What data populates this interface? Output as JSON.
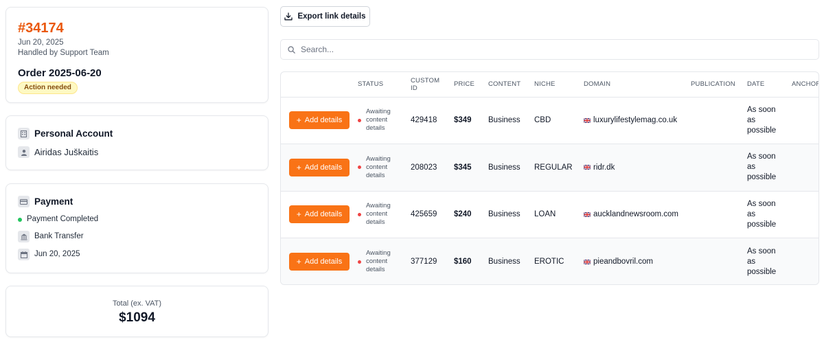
{
  "order": {
    "id": "#34174",
    "date": "Jun 20, 2025",
    "handler": "Handled by Support Team",
    "title": "Order 2025-06-20",
    "badge": "Action needed"
  },
  "account": {
    "title": "Personal Account",
    "name": "Airidas Juškaitis"
  },
  "payment": {
    "title": "Payment",
    "status": "Payment Completed",
    "method": "Bank Transfer",
    "date": "Jun 20, 2025"
  },
  "total": {
    "label": "Total (ex. VAT)",
    "value": "$1094"
  },
  "toolbar": {
    "export_label": "Export link details"
  },
  "search": {
    "placeholder": "Search..."
  },
  "table": {
    "columns": [
      "",
      "STATUS",
      "CUSTOM ID",
      "PRICE",
      "CONTENT",
      "NICHE",
      "DOMAIN",
      "PUBLICATION",
      "DATE",
      "ANCHOR"
    ],
    "add_label": "Add details",
    "rows": [
      {
        "status": "Awaiting content details",
        "custom_id": "429418",
        "price": "$349",
        "content": "Business",
        "niche": "CBD",
        "domain": "luxurylifestylemag.co.uk",
        "publication": "",
        "date": "As soon as possible"
      },
      {
        "status": "Awaiting content details",
        "custom_id": "208023",
        "price": "$345",
        "content": "Business",
        "niche": "REGULAR",
        "domain": "ridr.dk",
        "publication": "",
        "date": "As soon as possible"
      },
      {
        "status": "Awaiting content details",
        "custom_id": "425659",
        "price": "$240",
        "content": "Business",
        "niche": "LOAN",
        "domain": "aucklandnewsroom.com",
        "publication": "",
        "date": "As soon as possible"
      },
      {
        "status": "Awaiting content details",
        "custom_id": "377129",
        "price": "$160",
        "content": "Business",
        "niche": "EROTIC",
        "domain": "pieandbovril.com",
        "publication": "",
        "date": "As soon as possible"
      }
    ]
  },
  "colors": {
    "accent": "#f97316",
    "order_id": "#ea580c",
    "status_dot": "#ef4444",
    "payment_dot": "#22c55e"
  },
  "icons": {
    "account": "building-icon",
    "user": "user-icon",
    "payment": "credit-card-icon",
    "method": "bank-icon",
    "date": "calendar-icon",
    "export": "download-icon",
    "search": "search-icon",
    "flag": "uk-flag-icon"
  }
}
